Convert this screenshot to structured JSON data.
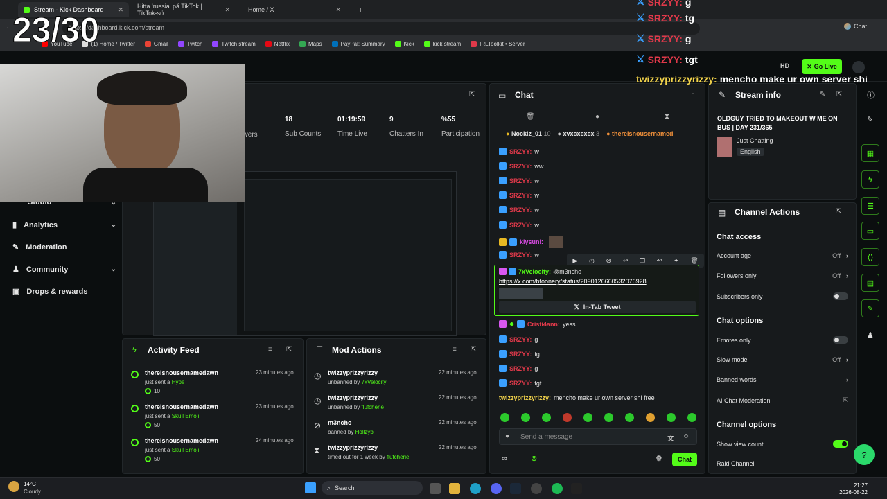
{
  "browser": {
    "tabs": [
      {
        "label": "Stream - Kick Dashboard",
        "active": true
      },
      {
        "label": "Hitta 'russia' på TikTok | TikTok-sö",
        "active": false
      },
      {
        "label": "Home / X",
        "active": false
      }
    ],
    "url": "https://dashboard.kick.com/stream",
    "bookmarks": [
      "YouTube",
      "(1) Home / Twitter",
      "Gmail",
      "Twitch",
      "Twitch stream",
      "Netflix",
      "Maps",
      "PayPal: Summary",
      "Kick",
      "kick stream",
      "IRLToolkit • Server"
    ],
    "chat_button": "Chat"
  },
  "overlay": {
    "counter": "23/30",
    "chat": [
      {
        "name": "SRZYY:",
        "msg": "g"
      },
      {
        "name": "SRZYY:",
        "msg": "tg"
      },
      {
        "name": "SRZYY:",
        "msg": "g"
      },
      {
        "name": "SRZYY:",
        "msg": "tgt"
      }
    ],
    "last": {
      "name": "twizzyprizzyrizzy:",
      "msg": "mencho make ur own server shi"
    }
  },
  "header": {
    "go_live": "Go Live"
  },
  "sidebar": {
    "items": [
      {
        "label": "Studio",
        "chevron": true
      },
      {
        "label": "Analytics",
        "chevron": true
      },
      {
        "label": "Moderation",
        "chevron": false
      },
      {
        "label": "Community",
        "chevron": true
      },
      {
        "label": "Drops & rewards",
        "chevron": false
      }
    ]
  },
  "stats": [
    {
      "value": "",
      "label": "owers"
    },
    {
      "value": "18",
      "label": "Sub Counts"
    },
    {
      "value": "01:19:59",
      "label": "Time Live"
    },
    {
      "value": "9",
      "label": "Chatters In"
    },
    {
      "value": "%55",
      "label": "Participation"
    }
  ],
  "activity_feed": {
    "title": "Activity Feed",
    "items": [
      {
        "name": "thereisnousernamedawn",
        "action": "just sent a",
        "item": "Hype",
        "amount": "10",
        "time": "23 minutes ago"
      },
      {
        "name": "thereisnousernamedawn",
        "action": "just sent a",
        "item": "Skull Emoji",
        "amount": "50",
        "time": "23 minutes ago"
      },
      {
        "name": "thereisnousernamedawn",
        "action": "just sent a",
        "item": "Skull Emoji",
        "amount": "50",
        "time": "24 minutes ago"
      }
    ]
  },
  "mod_actions": {
    "title": "Mod Actions",
    "items": [
      {
        "name": "twizzyprizzyrizzy",
        "action": "unbanned by",
        "by": "7xVelocity",
        "time": "22 minutes ago"
      },
      {
        "name": "twizzyprizzyrizzy",
        "action": "unbanned by",
        "by": "flufcherie",
        "time": "22 minutes ago"
      },
      {
        "name": "m3ncho",
        "action": "banned by",
        "by": "Hollzyb",
        "time": "22 minutes ago"
      },
      {
        "name": "twizzyprizzyrizzy",
        "action": "timed out for 1 week by",
        "by": "flufcherie",
        "time": "22 minutes ago"
      }
    ]
  },
  "chat": {
    "title": "Chat",
    "pinned_users": [
      {
        "name": "Nockiz_01",
        "count": "10"
      },
      {
        "name": "xvxcxcxcx",
        "count": "3"
      },
      {
        "name": "thereisnousernamed",
        "count": ""
      }
    ],
    "messages": [
      {
        "name": "SRZYY:",
        "msg": "w",
        "color": "red"
      },
      {
        "name": "SRZYY:",
        "msg": "ww",
        "color": "red"
      },
      {
        "name": "SRZYY:",
        "msg": "w",
        "color": "red"
      },
      {
        "name": "SRZYY:",
        "msg": "w",
        "color": "red"
      },
      {
        "name": "SRZYY:",
        "msg": "w",
        "color": "red"
      },
      {
        "name": "SRZYY:",
        "msg": "w",
        "color": "red"
      },
      {
        "name": "kiysuni:",
        "msg": "",
        "color": "mag"
      },
      {
        "name": "SRZYY:",
        "msg": "w",
        "color": "red"
      }
    ],
    "highlight": {
      "name": "7xVelocity:",
      "mention": "@m3ncho",
      "link": "https://x.com/bfoonery/status/2090126660532076928",
      "tweet_button": "In-Tab Tweet"
    },
    "messages2": [
      {
        "name": "Cristi4ann:",
        "msg": "yess",
        "color": "red"
      },
      {
        "name": "SRZYY:",
        "msg": "g",
        "color": "red"
      },
      {
        "name": "SRZYY:",
        "msg": "tg",
        "color": "red"
      },
      {
        "name": "SRZYY:",
        "msg": "g",
        "color": "red"
      },
      {
        "name": "SRZYY:",
        "msg": "tgt",
        "color": "red"
      }
    ],
    "last": {
      "name": "twizzyprizzyrizzy:",
      "msg": "mencho make ur own server shi free"
    },
    "placeholder": "Send a message",
    "send": "Chat"
  },
  "stream_info": {
    "title": "Stream info",
    "stream_title": "OLDGUY TRIED TO MAKEOUT W ME ON BUS | DAY 231/365",
    "category": "Just Chatting",
    "language": "English"
  },
  "channel_actions": {
    "title": "Channel Actions",
    "chat_access": "Chat access",
    "rows1": [
      {
        "label": "Account age",
        "value": "Off"
      },
      {
        "label": "Followers only",
        "value": "Off"
      },
      {
        "label": "Subscribers only",
        "value": ""
      }
    ],
    "chat_options": "Chat options",
    "rows2": [
      {
        "label": "Emotes only",
        "value": ""
      },
      {
        "label": "Slow mode",
        "value": "Off"
      },
      {
        "label": "Banned words",
        "value": ""
      },
      {
        "label": "AI Chat Moderation",
        "value": ""
      }
    ],
    "channel_options": "Channel options",
    "rows3": [
      {
        "label": "Show view count",
        "value": ""
      },
      {
        "label": "Raid Channel",
        "value": ""
      }
    ]
  },
  "taskbar": {
    "weather_temp": "14°C",
    "weather_desc": "Cloudy",
    "search": "Search",
    "time": "21:27",
    "date": "2026-08-22"
  },
  "colors": {
    "accent": "#53fc18",
    "panel": "#171a1c",
    "bg": "#0b0e0f"
  }
}
